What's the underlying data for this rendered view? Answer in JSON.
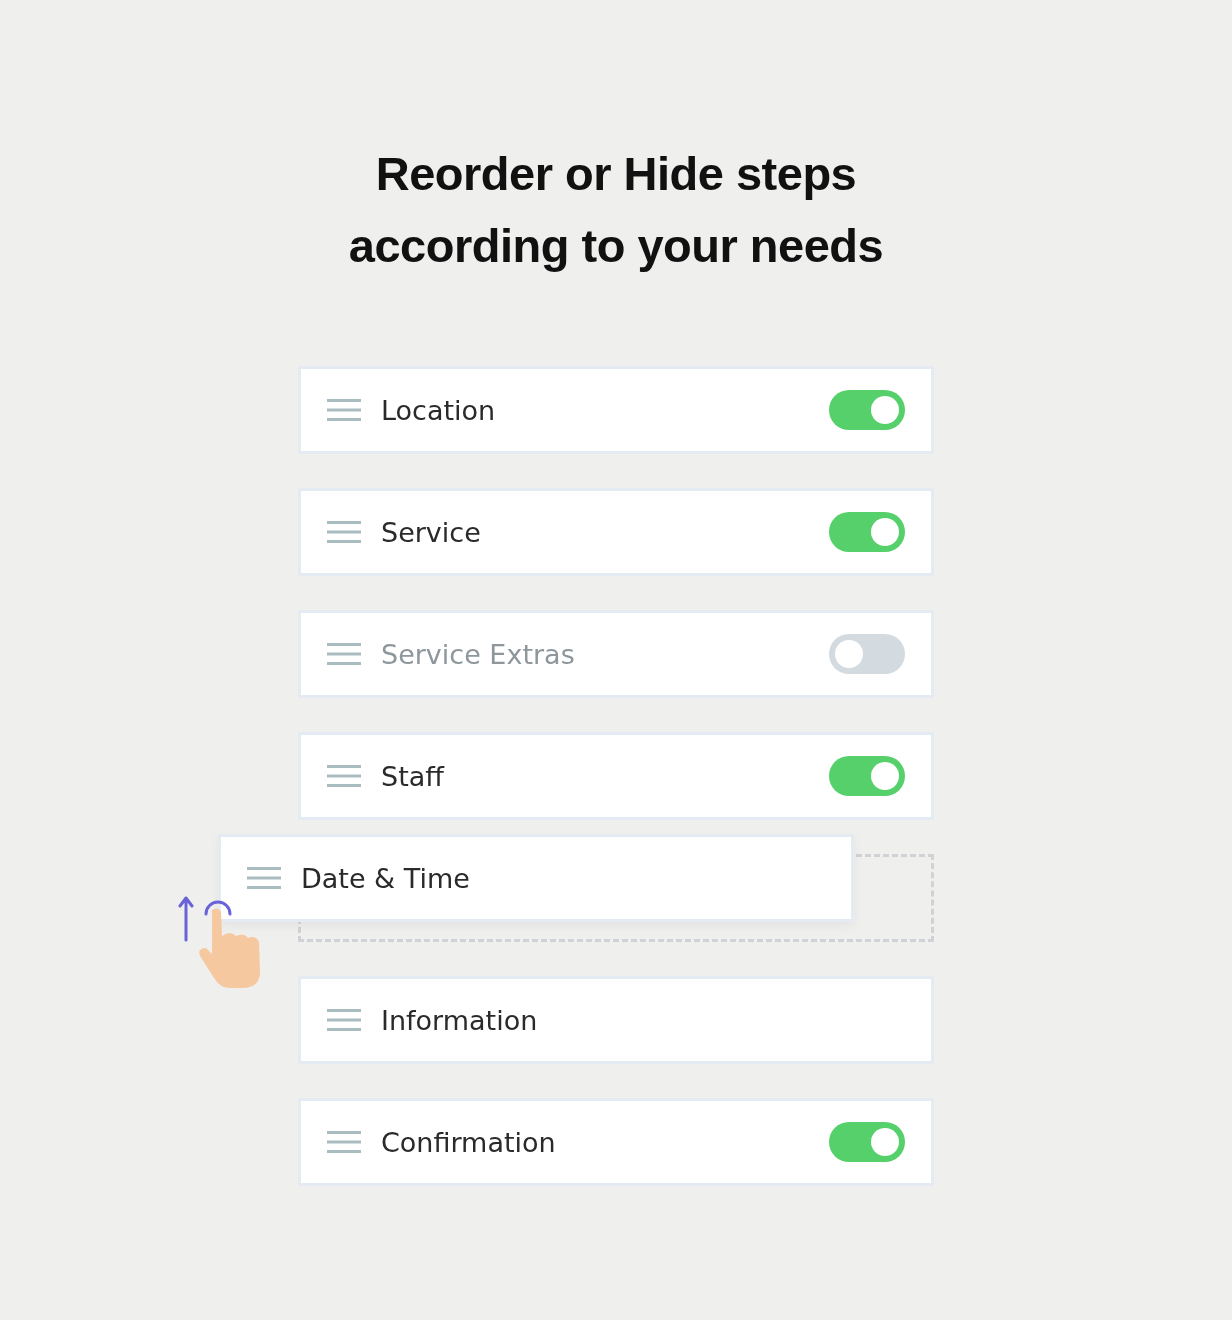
{
  "heading": [
    "Reorder or Hide steps",
    "according to your needs"
  ],
  "steps": [
    {
      "label": "Location",
      "kind": "toggle",
      "on": true,
      "dragging": false
    },
    {
      "label": "Service",
      "kind": "toggle",
      "on": true,
      "dragging": false
    },
    {
      "label": "Service Extras",
      "kind": "toggle",
      "on": false,
      "dragging": false
    },
    {
      "label": "Staff",
      "kind": "toggle",
      "on": true,
      "dragging": false
    },
    {
      "label": "Date & Time",
      "kind": "plain",
      "dragging": true
    },
    {
      "label": "Information",
      "kind": "plain",
      "dragging": false
    },
    {
      "label": "Confirmation",
      "kind": "toggle",
      "on": true,
      "dragging": false
    }
  ]
}
